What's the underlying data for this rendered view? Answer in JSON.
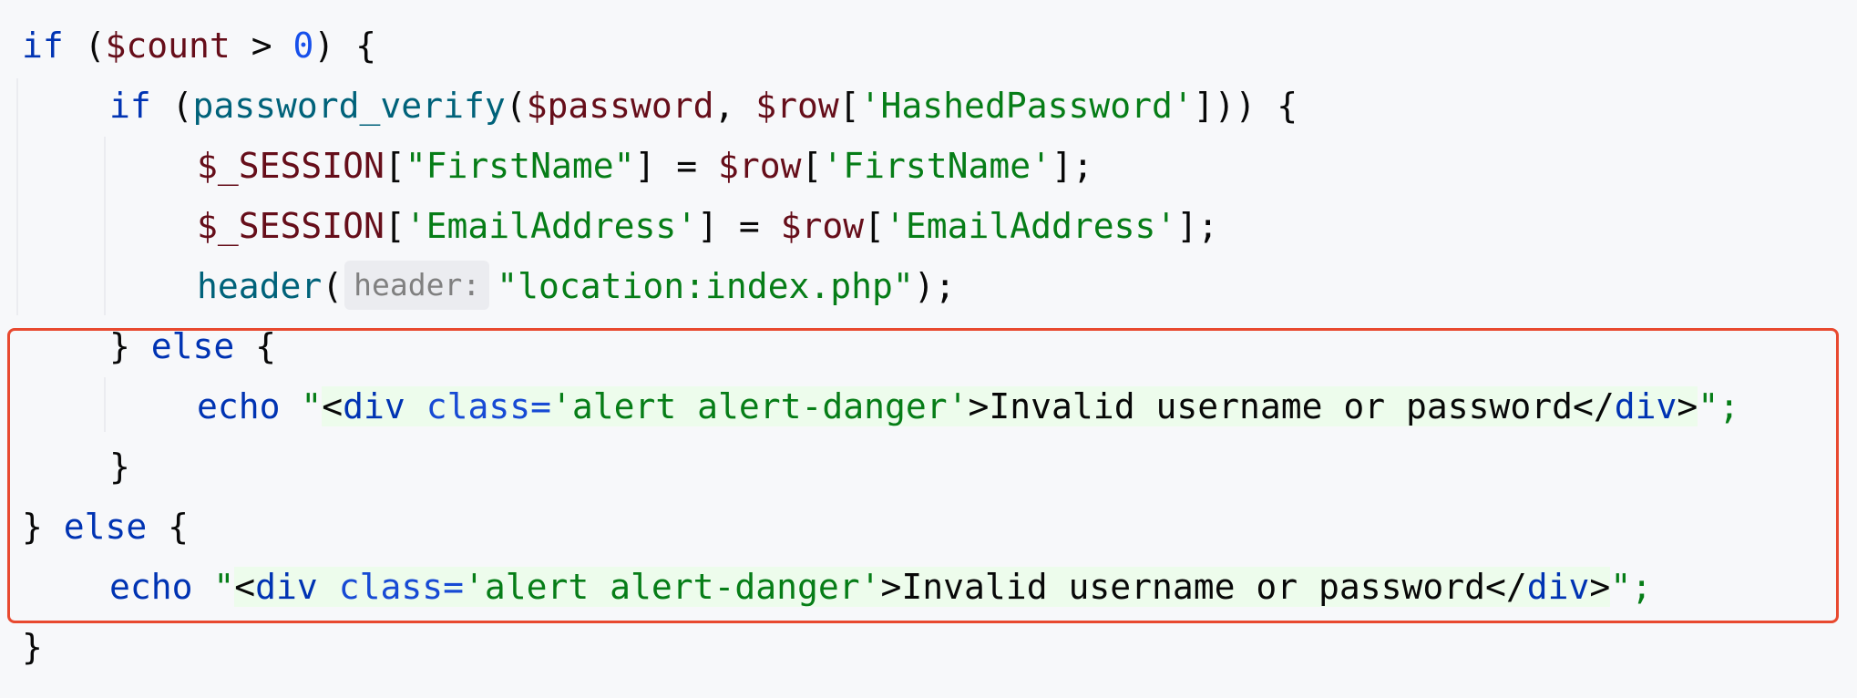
{
  "code": {
    "l1": {
      "kw_if": "if",
      "p1": " (",
      "var": "$count",
      "op": " > ",
      "num": "0",
      "p2": ") {"
    },
    "l2": {
      "kw_if": "if",
      "p1": " (",
      "fn": "password_verify",
      "p2": "(",
      "var1": "$password",
      "p3": ", ",
      "var2": "$row",
      "p4": "[",
      "str": "'HashedPassword'",
      "p5": "])) {"
    },
    "l3": {
      "var1": "$_SESSION",
      "p1": "[",
      "str1": "\"FirstName\"",
      "p2": "] = ",
      "var2": "$row",
      "p3": "[",
      "str2": "'FirstName'",
      "p4": "];"
    },
    "l4": {
      "var1": "$_SESSION",
      "p1": "[",
      "str1": "'EmailAddress'",
      "p2": "] = ",
      "var2": "$row",
      "p3": "[",
      "str2": "'EmailAddress'",
      "p4": "];"
    },
    "l5": {
      "fn": "header",
      "p1": "(",
      "hint": "header:",
      "str": "\"location:index.php\"",
      "p2": ");"
    },
    "l6": {
      "p1": "} ",
      "kw_else": "else",
      "p2": " {"
    },
    "l7": {
      "kw_echo": "echo",
      "q1": " \"",
      "t1": "<",
      "tag1": "div",
      "attr": " class=",
      "aval": "'alert alert-danger'",
      "t2": ">",
      "text": "Invalid username or password",
      "t3": "</",
      "tag2": "div",
      "t4": ">",
      "q2": "\";"
    },
    "l8": {
      "p1": "}"
    },
    "l9": {
      "p1": "} ",
      "kw_else": "else",
      "p2": " {"
    },
    "l10": {
      "kw_echo": "echo",
      "q1": " \"",
      "t1": "<",
      "tag1": "div",
      "attr": " class=",
      "aval": "'alert alert-danger'",
      "t2": ">",
      "text": "Invalid username or password",
      "t3": "</",
      "tag2": "div",
      "t4": ">",
      "q2": "\";"
    },
    "l11": {
      "p1": "}"
    }
  },
  "colors": {
    "keyword": "#0033b3",
    "variable": "#660e1a",
    "function": "#00627a",
    "string": "#067d17",
    "number": "#1750eb",
    "highlight_border": "#e8492f",
    "background": "#f7f8fa"
  }
}
